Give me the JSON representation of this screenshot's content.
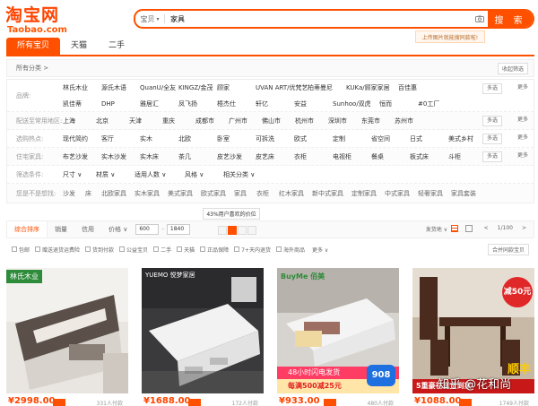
{
  "header": {
    "logo_cn": "淘宝网",
    "logo_en": "Taobao.com",
    "search_scope": "宝贝",
    "search_query": "家具",
    "search_button": "搜 索",
    "upload_tip": "上传图片就能搜同款啦!"
  },
  "tabs": [
    "所有宝贝",
    "天猫",
    "二手"
  ],
  "breadcrumb": {
    "label": "所有分类 >",
    "collapse": "收起筛选"
  },
  "filters": [
    {
      "label": "品牌:",
      "values": [
        "林氏木业",
        "源氏木语",
        "QuanU/全友",
        "KINGZ/金茂",
        "顾家",
        "UVAN ART/优梵艺术",
        "柏蒂曼尼",
        "KUKa/顾家家居",
        "百佳惠",
        "凯佳蒂",
        "DHP",
        "雅居汇",
        "凤飞扬",
        "梧杰仕",
        "轩亿",
        "安益",
        "Sunhoo/双虎",
        "恒而",
        "#0工厂"
      ],
      "multi": "多选",
      "more": "更多"
    },
    {
      "label": "配送至常用地区:",
      "values": [
        "上海",
        "北京",
        "天津",
        "重庆",
        "成都市",
        "广州市",
        "佛山市",
        "杭州市",
        "深圳市",
        "东莞市",
        "苏州市"
      ],
      "multi": "多选",
      "more": "更多"
    },
    {
      "label": "选购热点:",
      "values": [
        "现代简约",
        "客厅",
        "实木",
        "北欧",
        "卧室",
        "可拆洗",
        "欧式",
        "定制",
        "省空间",
        "日式",
        "美式乡村"
      ],
      "multi": "多选",
      "more": "更多"
    },
    {
      "label": "住宅家具:",
      "values": [
        "布艺沙发",
        "实木沙发",
        "实木床",
        "茶几",
        "皮艺沙发",
        "皮艺床",
        "衣柜",
        "电视柜",
        "餐桌",
        "板式床",
        "斗柜"
      ],
      "multi": "多选",
      "more": "更多"
    },
    {
      "label": "筛选条件:",
      "values": [
        "尺寸 ∨",
        "材质 ∨",
        "适用人数 ∨",
        "风格 ∨",
        "相关分类 ∨"
      ]
    },
    {
      "label": "您是不是想找:",
      "values": [
        "沙发",
        "床",
        "北欧家具",
        "实木家具",
        "美式家具",
        "欧式家具",
        "家具",
        "衣柜",
        "红木家具",
        "新中式家具",
        "定制家具",
        "中式家具",
        "轻奢家具",
        "家具套装"
      ]
    }
  ],
  "sort": {
    "items": [
      "综合排序",
      "销量",
      "信用",
      "价格 ∨"
    ],
    "price_min": "600",
    "price_max": "1840",
    "range_tip": "43%用户喜欢的价位",
    "ship_to": "发货地 ∨",
    "pager": [
      "<",
      "1/100",
      ">"
    ]
  },
  "checkboxes": [
    "包邮",
    "赠送退货运费险",
    "货到付款",
    "公益宝贝",
    "二手",
    "天猫",
    "正品保障",
    "7+天内退货",
    "海外商品"
  ],
  "checkbox_more": "更多 ∨",
  "location_button": "合并同款宝贝",
  "products": [
    {
      "price": "¥2998.00",
      "deals": "331人付款",
      "brand_tag": "林氏木业"
    },
    {
      "price": "¥1688.00",
      "deals": "172人付款",
      "brand_tag": "YUEMO 悦梦家居"
    },
    {
      "price": "¥933.00",
      "deals": "480人付款",
      "brand_tag": "BuyMe 佰美",
      "promo1": "48小时闪电发货",
      "promo2": "每满500减25元",
      "promo_num": "908"
    },
    {
      "price": "¥1088.00",
      "deals": "1749人付款",
      "promo1": "减50元",
      "promo2": "5重豪礼送货到家",
      "promo3": "顺丰"
    }
  ],
  "watermark": "知乎 @花和尚",
  "colors": {
    "accent": "#ff5000"
  }
}
